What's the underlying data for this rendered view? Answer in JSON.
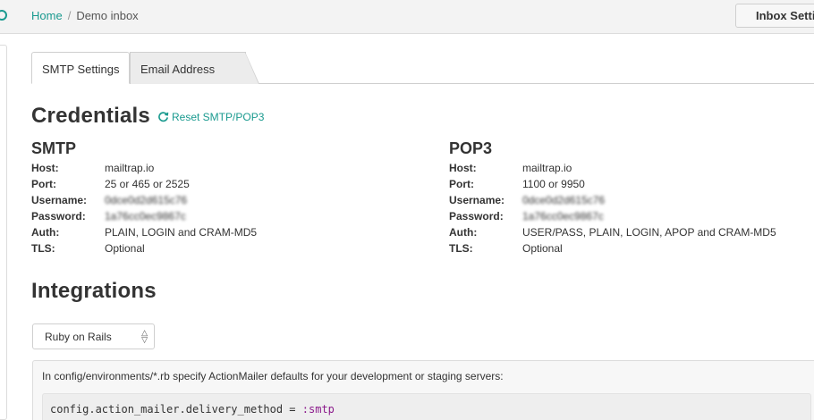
{
  "breadcrumb": {
    "home": "Home",
    "separator": "/",
    "current": "Demo inbox"
  },
  "header": {
    "inbox_settings_button": "Inbox Settings"
  },
  "tabs": [
    {
      "label": "SMTP Settings",
      "active": true
    },
    {
      "label": "Email Address",
      "active": false
    }
  ],
  "credentials": {
    "title": "Credentials",
    "reset_link": "Reset SMTP/POP3",
    "reset_icon": "refresh-icon"
  },
  "smtp": {
    "title": "SMTP",
    "rows": [
      {
        "key": "Host:",
        "value": "mailtrap.io"
      },
      {
        "key": "Port:",
        "value": "25 or 465 or 2525"
      },
      {
        "key": "Username:",
        "value": "0dce0d2d615c76"
      },
      {
        "key": "Password:",
        "value": "1a76cc0ec9867c"
      },
      {
        "key": "Auth:",
        "value": "PLAIN, LOGIN and CRAM-MD5"
      },
      {
        "key": "TLS:",
        "value": "Optional"
      }
    ]
  },
  "pop3": {
    "title": "POP3",
    "rows": [
      {
        "key": "Host:",
        "value": "mailtrap.io"
      },
      {
        "key": "Port:",
        "value": "1100 or 9950"
      },
      {
        "key": "Username:",
        "value": "0dce0d2d615c76"
      },
      {
        "key": "Password:",
        "value": "1a76cc0ec9867c"
      },
      {
        "key": "Auth:",
        "value": "USER/PASS, PLAIN, LOGIN, APOP and CRAM-MD5"
      },
      {
        "key": "TLS:",
        "value": "Optional"
      }
    ]
  },
  "integrations": {
    "title": "Integrations",
    "selected": "Ruby on Rails",
    "instructions": "In config/environments/*.rb specify ActionMailer defaults for your development or staging servers:",
    "code_prefix": "config.action_mailer.delivery_method = ",
    "code_symbol": ":smtp"
  },
  "colors": {
    "accent": "#1a9a8f",
    "symbol": "#8b1a8b"
  }
}
